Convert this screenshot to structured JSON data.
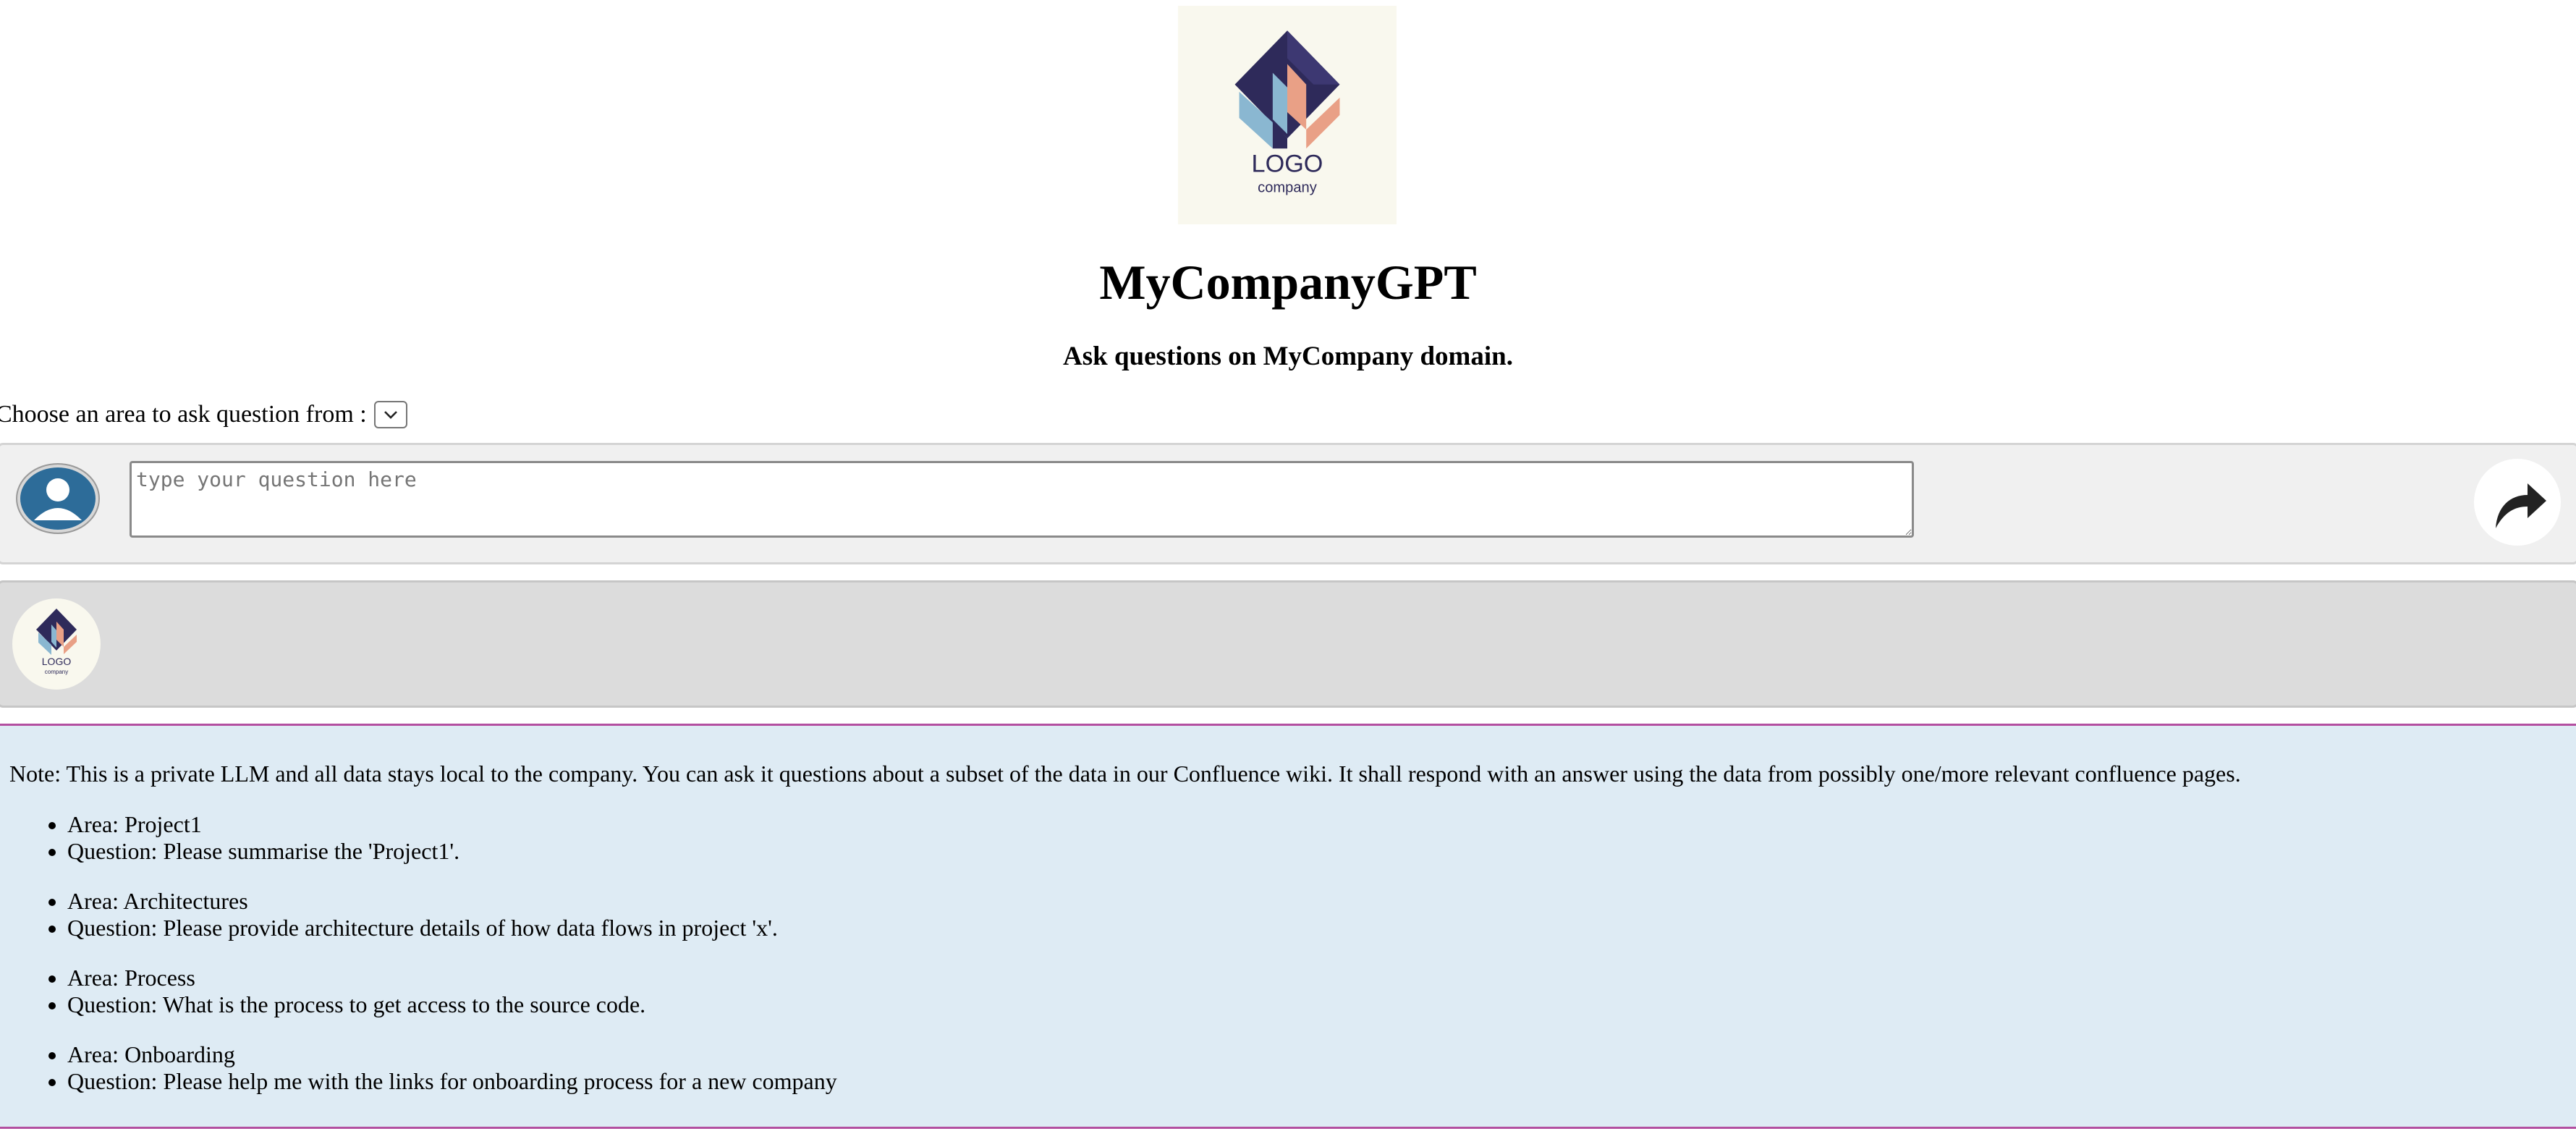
{
  "header": {
    "logo": {
      "text": "LOGO",
      "subtext": "company",
      "colors": {
        "background": "#f9f8ee",
        "navy": "#2e2a5a",
        "blue": "#8ab7d1",
        "peach": "#e9a086",
        "text": "#2e2a5a"
      }
    },
    "title": "MyCompanyGPT",
    "subtitle": "Ask questions on MyCompany domain."
  },
  "area_selector": {
    "label": "Choose an area to ask question from :",
    "selected_value": ""
  },
  "question": {
    "avatar_icon": "user-avatar-icon",
    "placeholder": "type your question here",
    "value": "",
    "send_icon": "share-arrow-icon"
  },
  "answer": {
    "avatar_icon": "company-logo-icon",
    "text": ""
  },
  "note": {
    "text": "Note: This is a private LLM and all data stays local to the company. You can ask it questions about a subset of the data in our Confluence wiki. It shall respond with an answer using the data from possibly one/more relevant confluence pages.",
    "examples": [
      {
        "area": "Area: Project1",
        "question": "Question: Please summarise the 'Project1'."
      },
      {
        "area": "Area: Architectures",
        "question": "Question: Please provide architecture details of how data flows in project 'x'."
      },
      {
        "area": "Area: Process",
        "question": "Question: What is the process to get access to the source code."
      },
      {
        "area": "Area: Onboarding",
        "question": "Question: Please help me with the links for onboarding process for a new company"
      }
    ],
    "colors": {
      "background": "#deebf4",
      "border": "#b34fa0"
    }
  }
}
